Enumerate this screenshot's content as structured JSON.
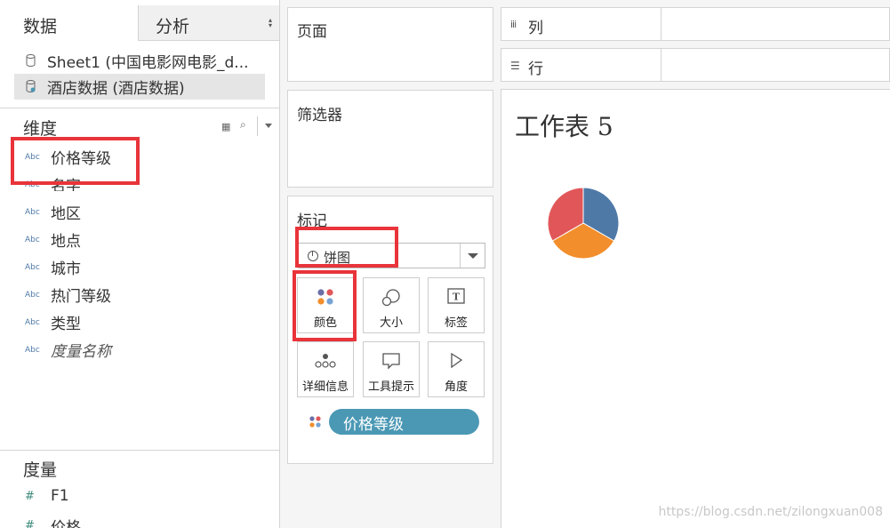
{
  "tabs": {
    "data": "数据",
    "analysis": "分析"
  },
  "datasources": [
    {
      "label": "Sheet1 (中国电影网电影_d..."
    },
    {
      "label": "酒店数据 (酒店数据)"
    }
  ],
  "dimensions": {
    "title": "维度",
    "fields": [
      "价格等级",
      "名字",
      "地区",
      "地点",
      "城市",
      "热门等级",
      "类型",
      "度量名称"
    ],
    "type_badge": "Abc"
  },
  "measures": {
    "title": "度量",
    "fields": [
      "F1",
      "价格"
    ],
    "type_badge": "#"
  },
  "pages_card": {
    "title": "页面"
  },
  "filters_card": {
    "title": "筛选器"
  },
  "marks_card": {
    "title": "标记",
    "mark_type": "饼图",
    "buttons": [
      "颜色",
      "大小",
      "标签",
      "详细信息",
      "工具提示",
      "角度"
    ],
    "color_pill": "价格等级"
  },
  "shelves": {
    "columns": "列",
    "rows": "行"
  },
  "worksheet": {
    "title": "工作表 5"
  },
  "chart_data": {
    "type": "pie",
    "slices": [
      {
        "color": "#4e79a7",
        "value": 1
      },
      {
        "color": "#f28e2b",
        "value": 1
      },
      {
        "color": "#e15759",
        "value": 1
      }
    ]
  },
  "watermark": "https://blog.csdn.net/zilongxuan008",
  "colors": {
    "pill": "#4a98b4",
    "highlight": "#e8343a",
    "abc_badge": "#4e7aa8"
  }
}
